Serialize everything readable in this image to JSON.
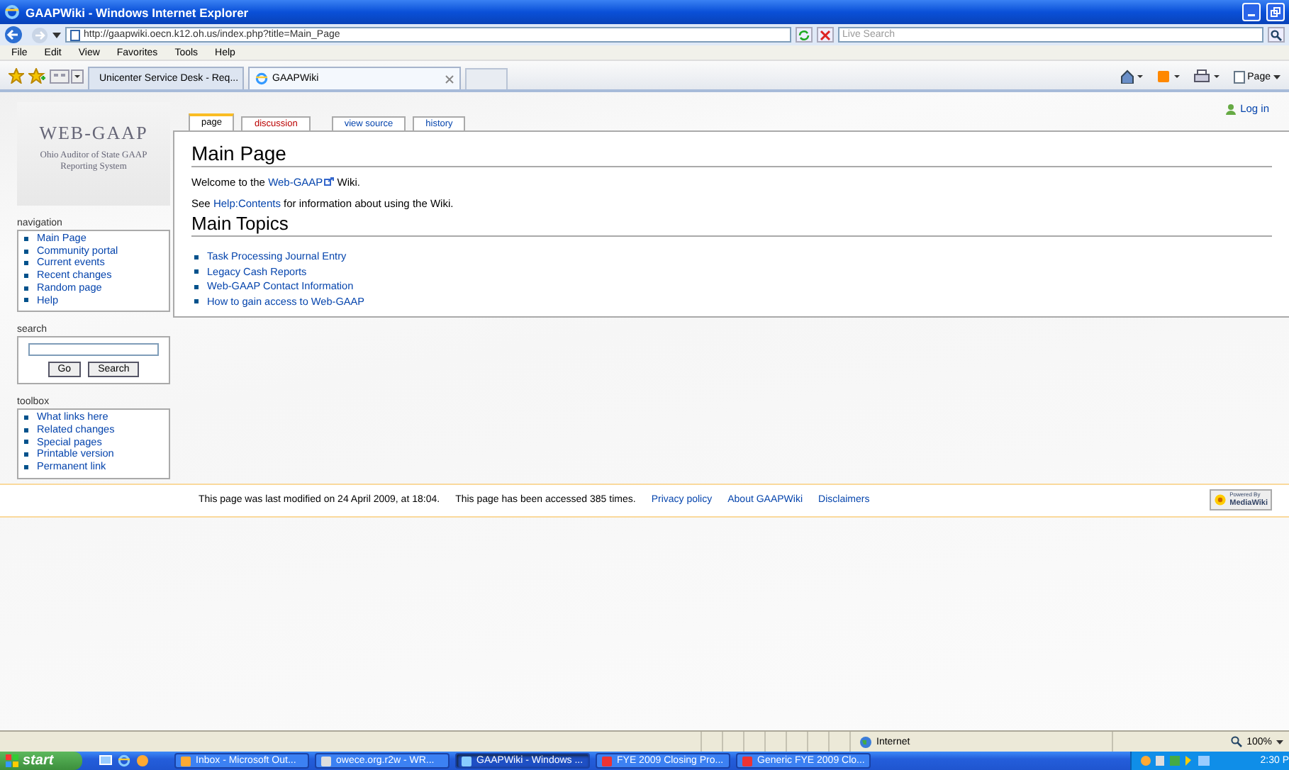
{
  "window": {
    "title": "GAAPWiki - Windows Internet Explorer"
  },
  "address_bar": {
    "url": "http://gaapwiki.oecn.k12.oh.us/index.php?title=Main_Page",
    "search_placeholder": "Live Search"
  },
  "menu": [
    "File",
    "Edit",
    "View",
    "Favorites",
    "Tools",
    "Help"
  ],
  "browser_tabs": [
    {
      "label": "Unicenter Service Desk - Req...",
      "selected": false
    },
    {
      "label": "GAAPWiki",
      "selected": true
    }
  ],
  "command_bar": {
    "page_menu": "Page"
  },
  "wiki": {
    "logo": {
      "title": "WEB-GAAP",
      "subtitle": "Ohio Auditor of State GAAP Reporting System"
    },
    "login": "Log in",
    "page_tabs": [
      {
        "label": "page",
        "selected": true
      },
      {
        "label": "discussion",
        "selected": false
      },
      {
        "label": "view source",
        "selected": false
      },
      {
        "label": "history",
        "selected": false
      }
    ],
    "heading": "Main Page",
    "paragraphs": [
      {
        "before": "Welcome to the ",
        "link": "Web-GAAP",
        "external": true,
        "after": " Wiki."
      },
      {
        "before": "See ",
        "link": "Help:Contents",
        "external": false,
        "after": " for information about using the Wiki."
      }
    ],
    "section": "Main Topics",
    "topics": [
      "Task Processing Journal Entry",
      "Legacy Cash Reports",
      "Web-GAAP Contact Information",
      "How to gain access to Web-GAAP"
    ],
    "navigation": {
      "title": "navigation",
      "items": [
        "Main Page",
        "Community portal",
        "Current events",
        "Recent changes",
        "Random page",
        "Help"
      ]
    },
    "search": {
      "title": "search",
      "buttons": [
        "Go",
        "Search"
      ]
    },
    "toolbox": {
      "title": "toolbox",
      "items": [
        "What links here",
        "Related changes",
        "Special pages",
        "Printable version",
        "Permanent link"
      ]
    },
    "footer": {
      "texts": [
        "This page was last modified on 24 April 2009, at 18:04.",
        "This page has been accessed 385 times."
      ],
      "links": [
        "Privacy policy",
        "About GAAPWiki",
        "Disclaimers"
      ],
      "badge": [
        "Powered By",
        "MediaWiki"
      ]
    }
  },
  "status_bar": {
    "zone": "Internet",
    "zoom": "100%"
  },
  "taskbar": {
    "start": "start",
    "items": [
      {
        "label": "Inbox - Microsoft Out...",
        "selected": false
      },
      {
        "label": "owece.org.r2w - WR...",
        "selected": false
      },
      {
        "label": "GAAPWiki - Windows ...",
        "selected": true
      },
      {
        "label": "FYE 2009 Closing Pro...",
        "selected": false
      },
      {
        "label": "Generic FYE 2009 Clo...",
        "selected": false
      }
    ],
    "clock": "2:30 P"
  }
}
